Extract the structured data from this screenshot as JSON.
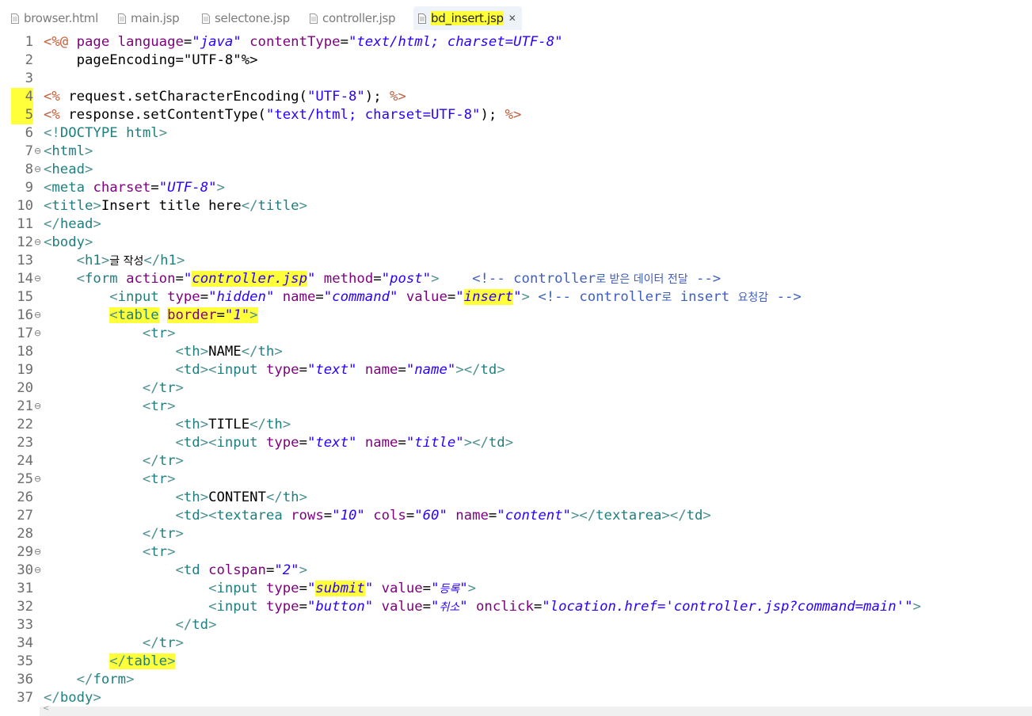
{
  "tabs": [
    {
      "label": "browser.html",
      "active": false
    },
    {
      "label": "main.jsp",
      "active": false
    },
    {
      "label": "selectone.jsp",
      "active": false
    },
    {
      "label": "controller.jsp",
      "active": false
    },
    {
      "label": "bd_insert.jsp",
      "active": true
    }
  ],
  "editor": {
    "file_icon": "file-icon",
    "close_icon": "close-icon",
    "fold_icon": "fold-collapse-icon",
    "colors": {
      "tag": "#1f7f7f",
      "attribute": "#7f007f",
      "value": "#2a00ff",
      "jsp": "#bf5f3f",
      "comment": "#3f5fbf",
      "highlight": "#ffff3a"
    },
    "lines": [
      "<%@ page language=\"java\" contentType=\"text/html; charset=UTF-8\"",
      "    pageEncoding=\"UTF-8\"%>",
      "",
      "<% request.setCharacterEncoding(\"UTF-8\"); %>",
      "<% response.setContentType(\"text/html; charset=UTF-8\"); %>",
      "<!DOCTYPE html>",
      "<html>",
      "<head>",
      "<meta charset=\"UTF-8\">",
      "<title>Insert title here</title>",
      "</head>",
      "<body>",
      "    <h1>글 작성</h1>",
      "    <form action=\"controller.jsp\" method=\"post\">    <!-- controller로 받은 데이터 전달 -->",
      "        <input type=\"hidden\" name=\"command\" value=\"insert\"> <!-- controller로 insert 요청감 -->",
      "        <table border=\"1\">",
      "            <tr>",
      "                <th>NAME</th>",
      "                <td><input type=\"text\" name=\"name\"></td>",
      "            </tr>",
      "            <tr>",
      "                <th>TITLE</th>",
      "                <td><input type=\"text\" name=\"title\"></td>",
      "            </tr>",
      "            <tr>",
      "                <th>CONTENT</th>",
      "                <td><textarea rows=\"10\" cols=\"60\" name=\"content\"></textarea></td>",
      "            </tr>",
      "            <tr>",
      "                <td colspan=\"2\">",
      "                    <input type=\"submit\" value=\"등록\">",
      "                    <input type=\"button\" value=\"취소\" onclick=\"location.href='controller.jsp?command=main'\">",
      "                </td>",
      "            </tr>",
      "        </table>",
      "    </form>",
      "</body>"
    ],
    "folded_lines": [
      7,
      8,
      12,
      14,
      16,
      17,
      21,
      25,
      29,
      30
    ],
    "highlighted_line_numbers": [
      4,
      5
    ]
  }
}
